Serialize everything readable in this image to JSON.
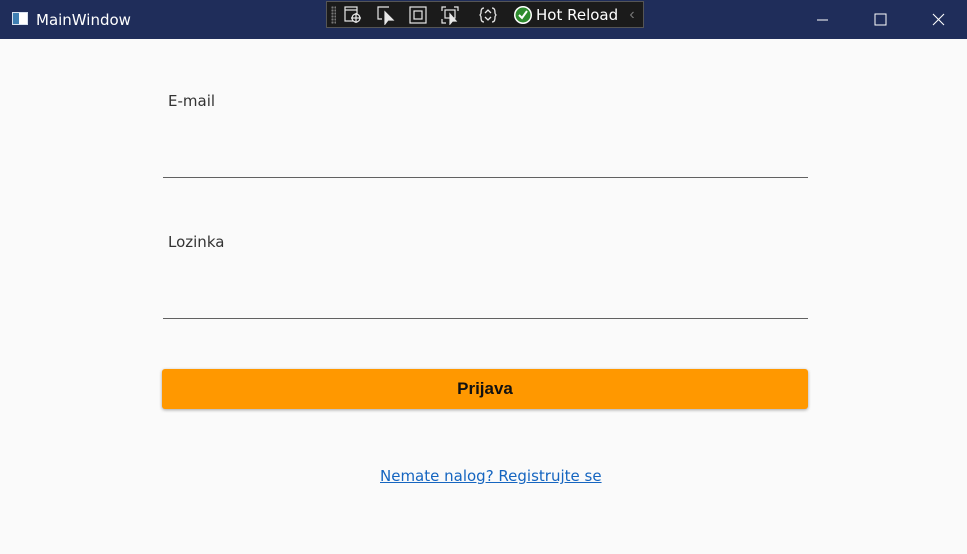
{
  "window": {
    "title": "MainWindow"
  },
  "devtools": {
    "hot_reload_label": "Hot Reload",
    "icons": [
      "select-element-icon",
      "display-adorners-icon",
      "track-focus-icon",
      "select-window-icon",
      "binding-failures-icon",
      "hot-reload-status-icon",
      "collapse-icon"
    ]
  },
  "form": {
    "email_label": "E-mail",
    "email_value": "",
    "password_label": "Lozinka",
    "password_value": "",
    "login_button": "Prijava",
    "register_link": "Nemate nalog? Registrujte se"
  },
  "colors": {
    "titlebar": "#1f2d5a",
    "button": "#ff9800",
    "link": "#1565c0",
    "background": "#fafafa"
  }
}
